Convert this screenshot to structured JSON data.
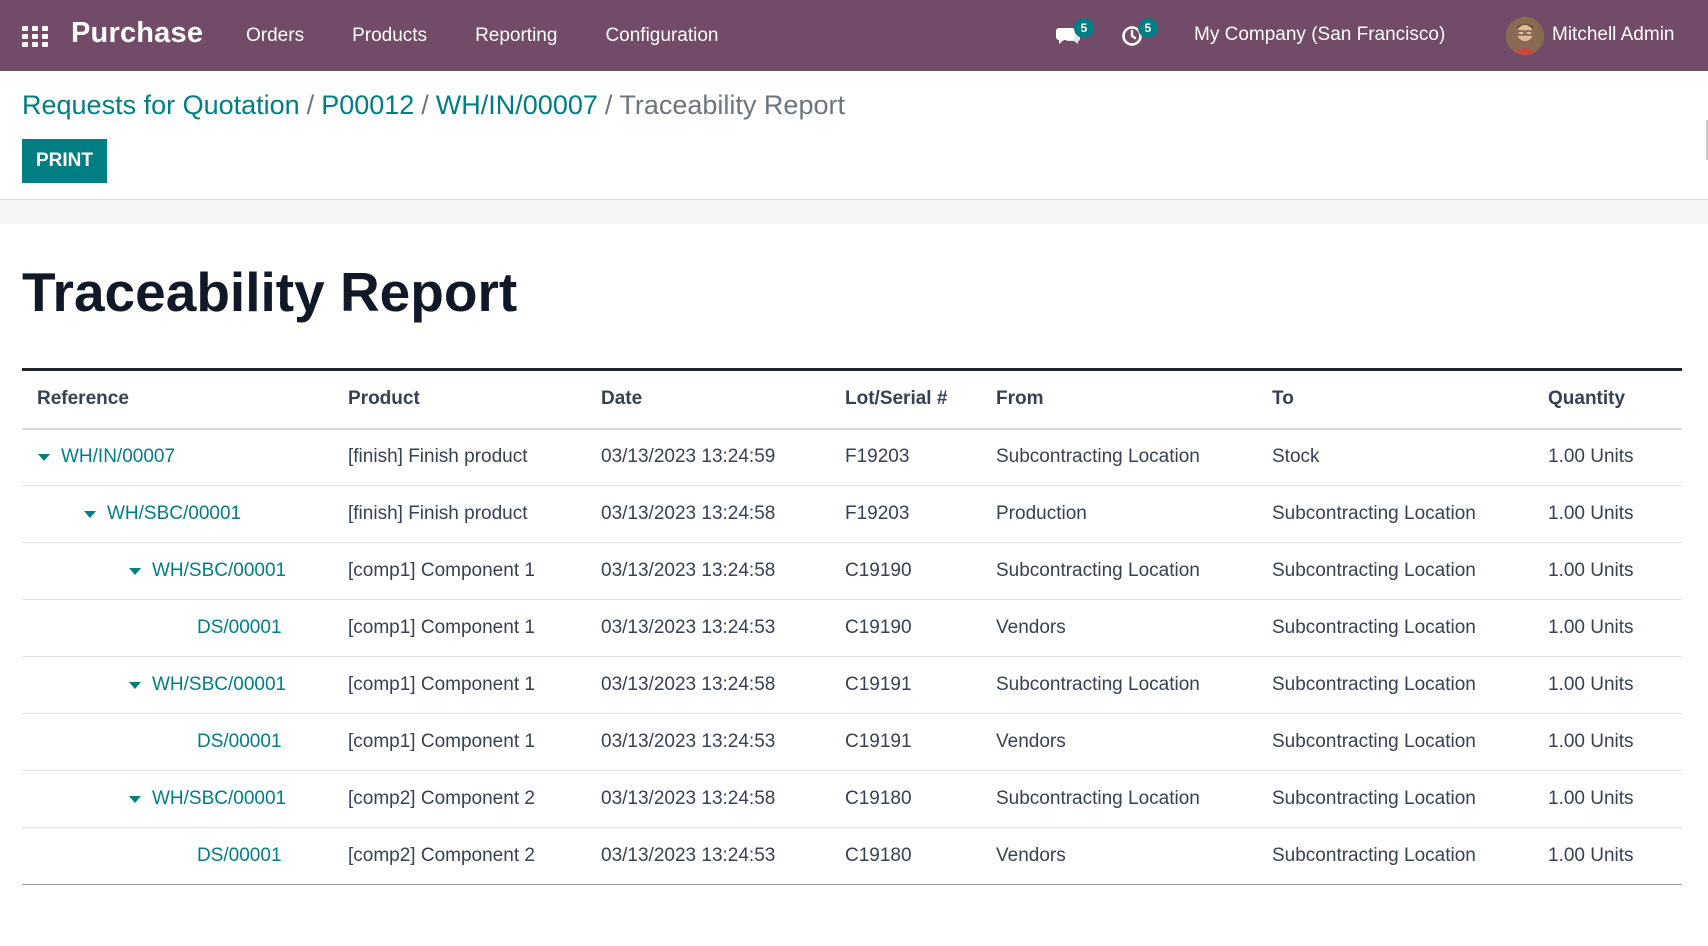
{
  "topbar": {
    "app_name": "Purchase",
    "menu": [
      "Orders",
      "Products",
      "Reporting",
      "Configuration"
    ],
    "messages_count": "5",
    "activities_count": "5",
    "company": "My Company (San Francisco)",
    "user_name": "Mitchell Admin",
    "bg_color": "#714b67"
  },
  "breadcrumb": {
    "items": [
      "Requests for Quotation",
      "P00012",
      "WH/IN/00007"
    ],
    "separator": "/",
    "current": "Traceability Report"
  },
  "toolbar": {
    "print_label": "PRINT"
  },
  "report": {
    "title": "Traceability Report",
    "columns": [
      "Reference",
      "Product",
      "Date",
      "Lot/Serial #",
      "From",
      "To",
      "Quantity"
    ],
    "rows": [
      {
        "reference": "WH/IN/00007",
        "product": "[finish] Finish product",
        "date": "03/13/2023 13:24:59",
        "lot": "F19203",
        "from": "Subcontracting Location",
        "to": "Stock",
        "quantity": "1.00 Units",
        "level": 0,
        "expandable": true
      },
      {
        "reference": "WH/SBC/00001",
        "product": "[finish] Finish product",
        "date": "03/13/2023 13:24:58",
        "lot": "F19203",
        "from": "Production",
        "to": "Subcontracting Location",
        "quantity": "1.00 Units",
        "level": 1,
        "expandable": true
      },
      {
        "reference": "WH/SBC/00001",
        "product": "[comp1] Component 1",
        "date": "03/13/2023 13:24:58",
        "lot": "C19190",
        "from": "Subcontracting Location",
        "to": "Subcontracting Location",
        "quantity": "1.00 Units",
        "level": 2,
        "expandable": true
      },
      {
        "reference": "DS/00001",
        "product": "[comp1] Component 1",
        "date": "03/13/2023 13:24:53",
        "lot": "C19190",
        "from": "Vendors",
        "to": "Subcontracting Location",
        "quantity": "1.00 Units",
        "level": 3,
        "expandable": false
      },
      {
        "reference": "WH/SBC/00001",
        "product": "[comp1] Component 1",
        "date": "03/13/2023 13:24:58",
        "lot": "C19191",
        "from": "Subcontracting Location",
        "to": "Subcontracting Location",
        "quantity": "1.00 Units",
        "level": 2,
        "expandable": true
      },
      {
        "reference": "DS/00001",
        "product": "[comp1] Component 1",
        "date": "03/13/2023 13:24:53",
        "lot": "C19191",
        "from": "Vendors",
        "to": "Subcontracting Location",
        "quantity": "1.00 Units",
        "level": 3,
        "expandable": false
      },
      {
        "reference": "WH/SBC/00001",
        "product": "[comp2] Component 2",
        "date": "03/13/2023 13:24:58",
        "lot": "C19180",
        "from": "Subcontracting Location",
        "to": "Subcontracting Location",
        "quantity": "1.00 Units",
        "level": 2,
        "expandable": true
      },
      {
        "reference": "DS/00001",
        "product": "[comp2] Component 2",
        "date": "03/13/2023 13:24:53",
        "lot": "C19180",
        "from": "Vendors",
        "to": "Subcontracting Location",
        "quantity": "1.00 Units",
        "level": 3,
        "expandable": false
      }
    ]
  },
  "colors": {
    "accent": "#017e84",
    "header": "#714b67"
  },
  "icons": {
    "apps": "apps-grid-icon",
    "messages": "chat-icon",
    "activities": "clock-icon",
    "row_toggle": "caret-down-icon"
  }
}
